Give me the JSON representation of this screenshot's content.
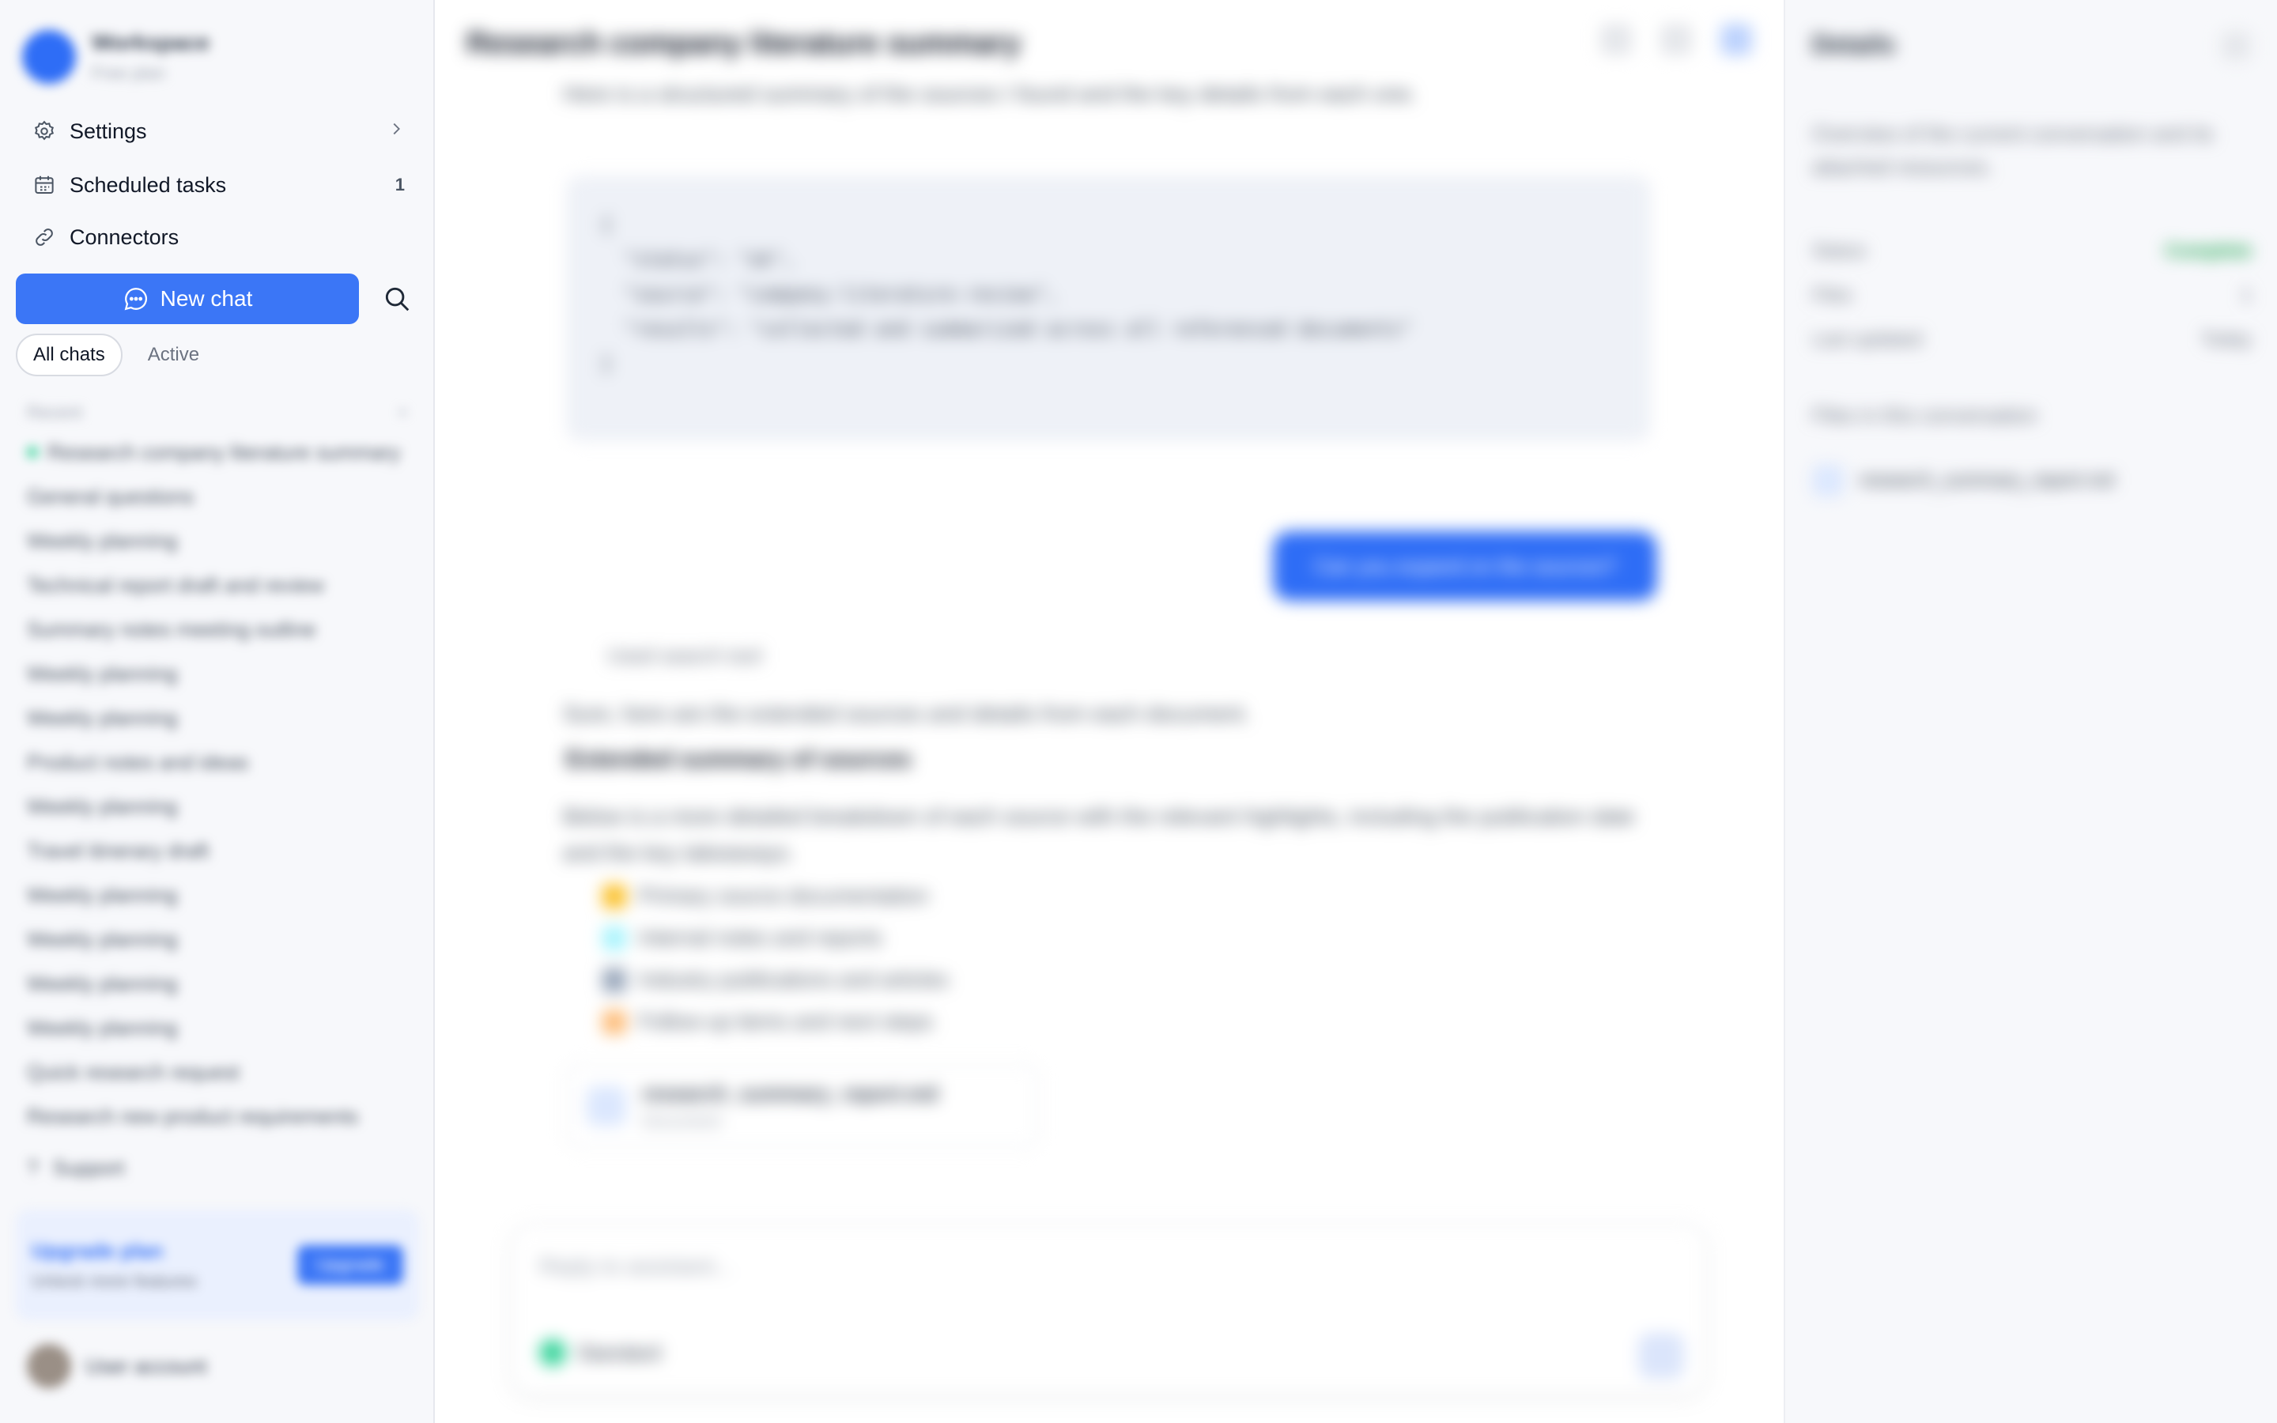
{
  "sidebar": {
    "workspace": {
      "name": "Workspace",
      "subtitle": "Free plan"
    },
    "nav": [
      {
        "label": "Settings",
        "icon": "gear-icon",
        "trail": ""
      },
      {
        "label": "Scheduled tasks",
        "icon": "calendar-icon",
        "trail": "1"
      },
      {
        "label": "Connectors",
        "icon": "link-icon",
        "trail": ""
      }
    ],
    "new_chat_label": "New chat",
    "filters": {
      "all": "All chats",
      "active": "Active"
    },
    "section_label": "Recent",
    "chats": [
      "Research company literature summary",
      "General questions",
      "Weekly planning",
      "Technical report draft and review",
      "Summary notes meeting outline",
      "Weekly planning",
      "Weekly planning",
      "Product notes and ideas",
      "Weekly planning",
      "Travel itinerary draft",
      "Weekly planning",
      "Weekly planning",
      "Weekly planning",
      "Weekly planning",
      "Quick research request",
      "Research new product requirements"
    ],
    "footer_link": "Support",
    "upgrade": {
      "title": "Upgrade plan",
      "desc": "Unlock more features",
      "button": "Upgrade"
    },
    "profile_name": "User account"
  },
  "main": {
    "title": "Research company literature summary",
    "para1": "Here is a structured summary of the sources I found and the key details from each one.",
    "code": "{\n  \"status\": \"ok\",\n  \"source\": \"company-literature-review\",\n  \"results\": \"collected and summarized across all referenced documents\"\n}",
    "user_message": "Can you expand on the sources?",
    "tool_line": "Used search tool",
    "para2": "Sure, here are the extended sources and details from each document.",
    "heading": "Extended summary of sources",
    "para3": "Below is a more detailed breakdown of each source with the relevant highlights, including the publication date and the key takeaways.",
    "bullets": [
      "Primary source documentation",
      "Internal notes and reports",
      "Industry publications and articles",
      "Follow-up items and next steps"
    ],
    "file_card": {
      "name": "research_summary_report.md",
      "meta": "Document"
    },
    "composer_placeholder": "Reply to assistant...",
    "model_label": "Standard"
  },
  "right_panel": {
    "title": "Details",
    "desc": "Overview of the current conversation and its attached resources.",
    "stats": [
      {
        "label": "Status",
        "value": "Complete"
      },
      {
        "label": "Files",
        "value": "1"
      },
      {
        "label": "Last updated",
        "value": "Today"
      }
    ],
    "section": "Files in this conversation",
    "item": "research_summary_report.md"
  },
  "colors": {
    "accent": "#3b76f6",
    "sidebar_bg": "#f7f8fb"
  }
}
